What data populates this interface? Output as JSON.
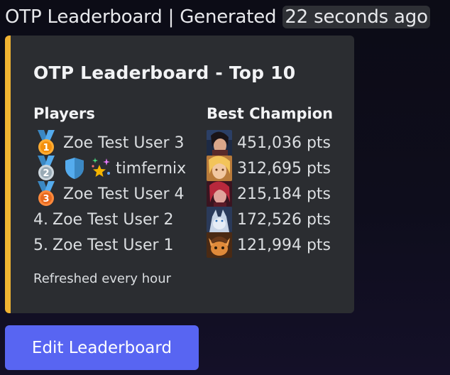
{
  "header": {
    "text": "OTP Leaderboard | Generated",
    "timestamp": "22 seconds ago"
  },
  "embed": {
    "accent_color": "#f0b232",
    "title": "OTP Leaderboard - Top 10",
    "players_header": "Players",
    "champion_header": "Best Champion",
    "players": [
      {
        "rank_label": "",
        "medal": "gold-medal-icon",
        "name": "Zoe Test User 3"
      },
      {
        "rank_label": "",
        "medal": "silver-medal-icon",
        "badges": [
          "shield-icon",
          "sparkle-star-icon"
        ],
        "name": "timfernix"
      },
      {
        "rank_label": "",
        "medal": "bronze-medal-icon",
        "name": "Zoe Test User 4"
      },
      {
        "rank_label": "4.",
        "name": "Zoe Test User 2"
      },
      {
        "rank_label": "5.",
        "name": "Zoe Test User 1"
      }
    ],
    "champions": [
      {
        "icon": "champion-portrait-dark-haired",
        "points": "451,036 pts"
      },
      {
        "icon": "champion-portrait-blonde",
        "points": "312,695 pts"
      },
      {
        "icon": "champion-portrait-red-haired",
        "points": "215,184 pts"
      },
      {
        "icon": "champion-portrait-wolf",
        "points": "172,526 pts"
      },
      {
        "icon": "champion-portrait-yordle",
        "points": "121,994 pts"
      }
    ],
    "footer": "Refreshed every hour"
  },
  "button": {
    "label": "Edit Leaderboard",
    "color": "#5865f2"
  }
}
